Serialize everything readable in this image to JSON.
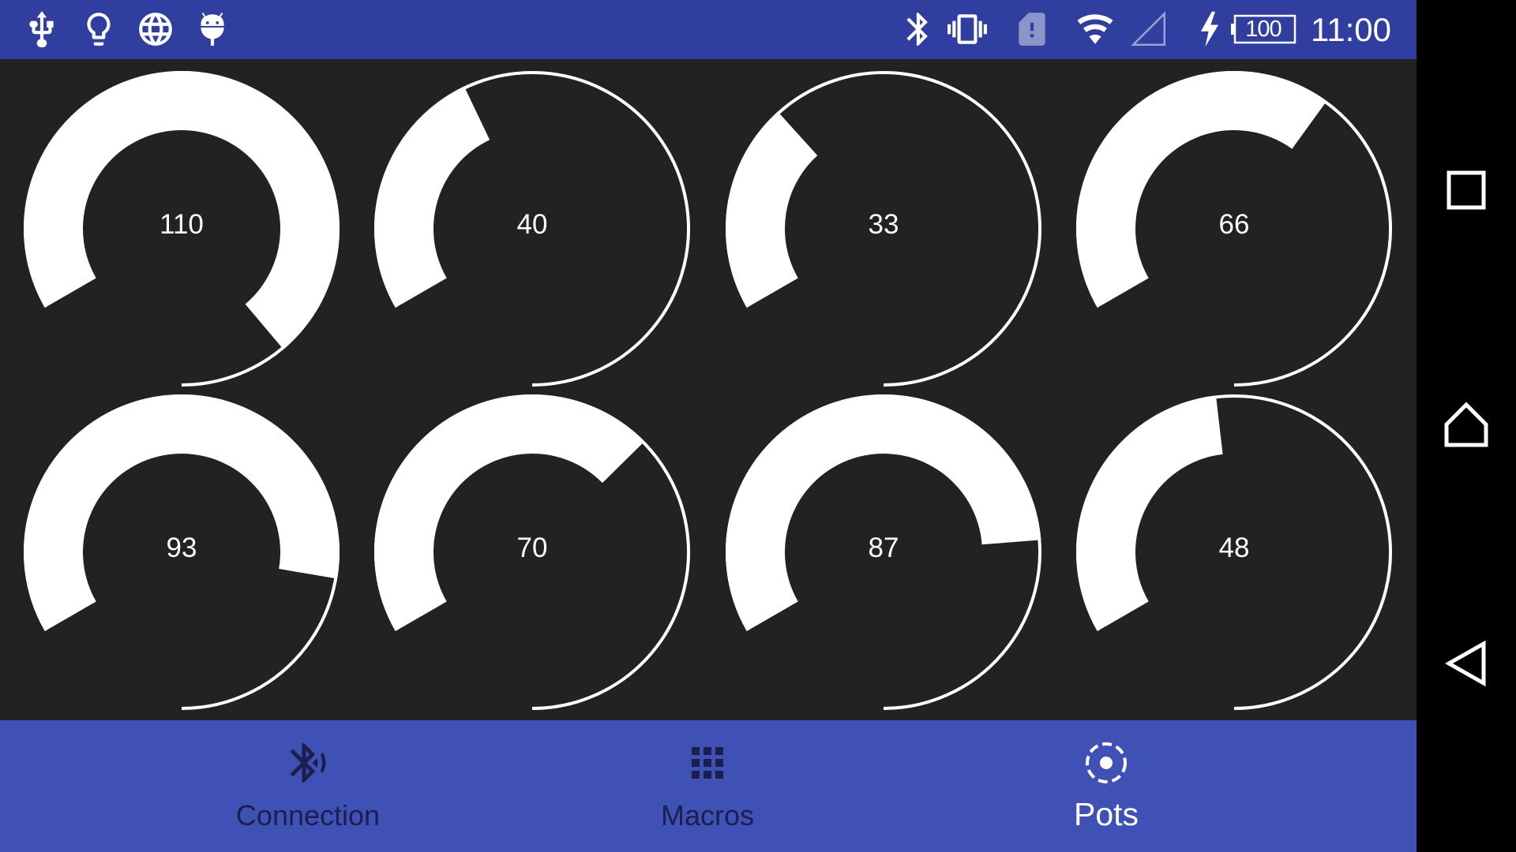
{
  "status_bar": {
    "left_icons": [
      "usb-icon",
      "lightbulb-icon",
      "globe-icon",
      "android-icon"
    ],
    "right_icons": [
      "bluetooth-icon",
      "vibrate-icon",
      "sim-alert-icon",
      "wifi-icon",
      "cell-signal-icon",
      "charging-icon"
    ],
    "battery_level": "100",
    "time": "11:00",
    "background": "#303F9F"
  },
  "knobs": [
    {
      "value": "110",
      "level": 110
    },
    {
      "value": "40",
      "level": 40
    },
    {
      "value": "33",
      "level": 33
    },
    {
      "value": "66",
      "level": 66
    },
    {
      "value": "93",
      "level": 93
    },
    {
      "value": "70",
      "level": 70
    },
    {
      "value": "87",
      "level": 87
    },
    {
      "value": "48",
      "level": 48
    }
  ],
  "knob_scale_max": 127,
  "knob_colors": {
    "fill": "#FFFFFF",
    "track": "#FFFFFF",
    "background": "#222222"
  },
  "bottom_nav": {
    "background": "#3F51B5",
    "items": [
      {
        "label": "Connection",
        "icon": "bluetooth-searching-icon",
        "active": false
      },
      {
        "label": "Macros",
        "icon": "grid-icon",
        "active": false
      },
      {
        "label": "Pots",
        "icon": "knob-icon",
        "active": true
      }
    ]
  },
  "system_nav": {
    "buttons": [
      "recents-icon",
      "home-icon",
      "back-icon"
    ]
  }
}
